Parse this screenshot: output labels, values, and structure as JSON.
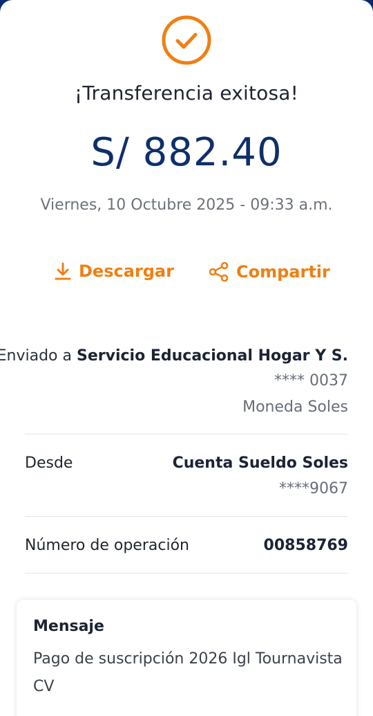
{
  "header": {
    "title": "¡Transferencia exitosa!",
    "amount": "S/ 882.40",
    "datetime": "Viernes, 10 Octubre 2025 - 09:33 a.m."
  },
  "actions": {
    "download_label": "Descargar",
    "share_label": "Compartir"
  },
  "details": {
    "sent_to_prefix": "Enviado a ",
    "recipient_name": "Servicio Educacional Hogar Y S.",
    "recipient_account": "**** 0037",
    "currency": "Moneda Soles",
    "from_label": "Desde",
    "from_account_name": "Cuenta Sueldo Soles",
    "from_account_number": "****9067",
    "operation_label": "Número de operación",
    "operation_number": "00858769"
  },
  "message": {
    "title": "Mensaje",
    "body": "Pago de suscripción 2026 Igl Tournavista CV"
  },
  "colors": {
    "accent": "#f07f13",
    "amount": "#0f2f6b",
    "header_bg": "#0b2a6b"
  },
  "icons": {
    "status": "check-circle-icon",
    "download": "download-icon",
    "share": "share-icon"
  }
}
